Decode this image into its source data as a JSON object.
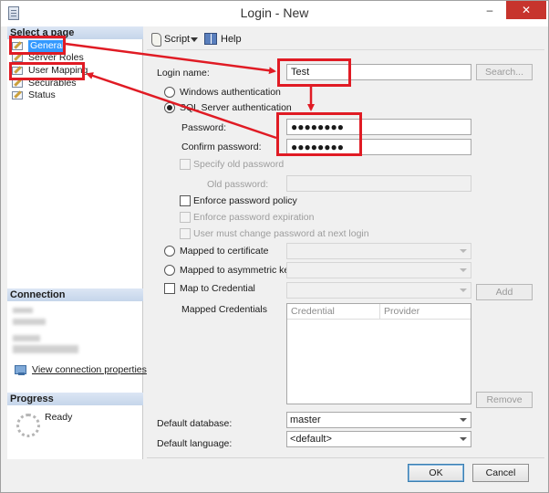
{
  "window": {
    "title": "Login - New"
  },
  "left_pane": {
    "select_page_header": "Select a page",
    "pages": [
      {
        "label": "General",
        "selected": true
      },
      {
        "label": "Server Roles",
        "selected": false
      },
      {
        "label": "User Mapping",
        "selected": false
      },
      {
        "label": "Securables",
        "selected": false
      },
      {
        "label": "Status",
        "selected": false
      }
    ],
    "connection_header": "Connection",
    "view_connection_properties": "View connection properties",
    "progress_header": "Progress",
    "progress_status": "Ready"
  },
  "toolbar": {
    "script_label": "Script",
    "help_label": "Help"
  },
  "general": {
    "login_name_label": "Login name:",
    "login_name_value": "Test",
    "search_button": "Search...",
    "windows_auth": "Windows authentication",
    "sql_auth": "SQL Server authentication",
    "password_label": "Password:",
    "password_value": "●●●●●●●●",
    "confirm_password_label": "Confirm password:",
    "confirm_password_value": "●●●●●●●●",
    "specify_old_password": "Specify old password",
    "old_password_label": "Old password:",
    "enforce_policy": "Enforce password policy",
    "enforce_expiration": "Enforce password expiration",
    "must_change": "User must change password at next login",
    "mapped_to_certificate": "Mapped to certificate",
    "mapped_to_asymmetric_key": "Mapped to asymmetric key",
    "map_to_credential": "Map to Credential",
    "add_button": "Add",
    "mapped_credentials_label": "Mapped Credentials",
    "credentials_columns": [
      "Credential",
      "Provider"
    ],
    "remove_button": "Remove",
    "default_database_label": "Default database:",
    "default_database_value": "master",
    "default_language_label": "Default language:",
    "default_language_value": "<default>"
  },
  "footer": {
    "ok_button": "OK",
    "cancel_button": "Cancel"
  },
  "annotation_color": "#e01b24"
}
